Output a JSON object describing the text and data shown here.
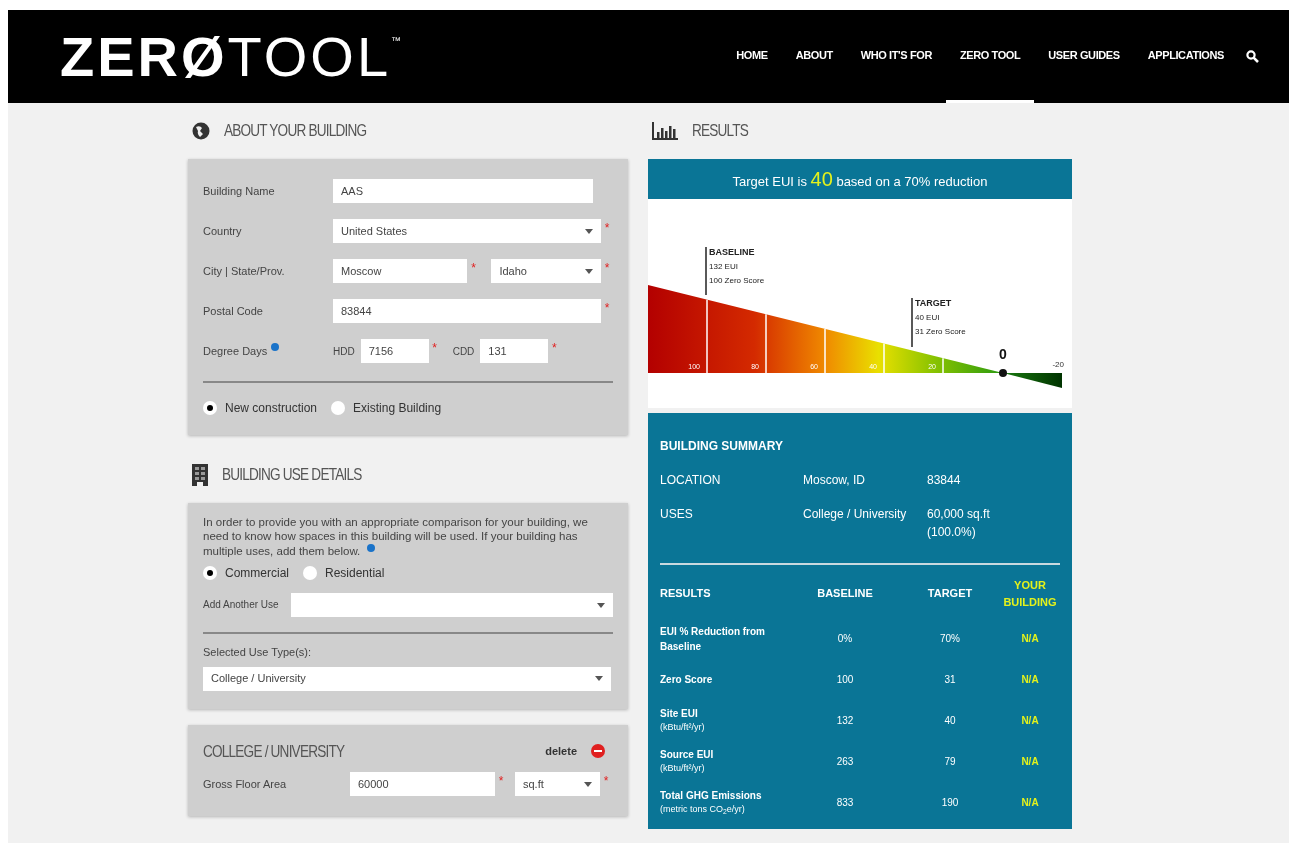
{
  "header": {
    "logo": {
      "bold": "ZERØ",
      "light": "TOOL",
      "mark": "™"
    },
    "nav": [
      {
        "label": "HOME",
        "selected": false
      },
      {
        "label": "ABOUT",
        "selected": false
      },
      {
        "label": "WHO IT'S FOR",
        "selected": false
      },
      {
        "label": "ZERO TOOL",
        "selected": true
      },
      {
        "label": "USER GUIDES",
        "selected": false
      },
      {
        "label": "APPLICATIONS",
        "selected": false
      }
    ]
  },
  "about": {
    "title": "ABOUT YOUR BUILDING",
    "fields": [
      {
        "label": "Building Name",
        "info": false,
        "inputs": [
          {
            "kind": "text",
            "value": "AAS"
          }
        ]
      },
      {
        "label": "Country",
        "info": false,
        "inputs": [
          {
            "kind": "select",
            "value": "United States",
            "required_mark": "*"
          }
        ]
      },
      {
        "label": "City | State/Prov.",
        "info": false,
        "inputs": [
          {
            "kind": "text",
            "value": "Moscow",
            "required_mark": "*"
          },
          {
            "kind": "select",
            "value": "Idaho",
            "required_mark": "*"
          }
        ]
      },
      {
        "label": "Postal Code",
        "info": false,
        "inputs": [
          {
            "kind": "text",
            "value": "83844",
            "required_mark": "*"
          }
        ]
      },
      {
        "label": "Degree Days",
        "info": true,
        "inputs": [
          {
            "kind": "text",
            "prefix": "HDD",
            "value": "7156",
            "required_mark": "*"
          },
          {
            "kind": "text",
            "prefix": "CDD",
            "value": "131",
            "required_mark": "*"
          }
        ]
      }
    ],
    "radios": [
      {
        "label": "New construction",
        "selected": true
      },
      {
        "label": "Existing Building",
        "selected": false
      }
    ]
  },
  "use_details": {
    "title": "BUILDING USE DETAILS",
    "intro": "In order to provide you with an appropriate comparison for your building, we need to know how spaces in this building will be used. If your building has multiple uses, add them below.",
    "radios": [
      {
        "label": "Commercial",
        "selected": true
      },
      {
        "label": "Residential",
        "selected": false
      }
    ],
    "add_use_label": "Add Another Use",
    "selected_label": "Selected Use Type(s):",
    "selected_value": "College / University"
  },
  "use_card": {
    "title": "COLLEGE / UNIVERSITY",
    "delete": "delete",
    "label": "Gross Floor Area",
    "inputs": [
      {
        "kind": "text",
        "value": "60000",
        "required_mark": "*"
      },
      {
        "kind": "select",
        "value": "sq.ft",
        "required_mark": "*"
      }
    ]
  },
  "results": {
    "title": "RESULTS",
    "banner": "Target EUI is **40** based on a 70% reduction",
    "gauge": {
      "scale": [
        "100",
        "80",
        "60",
        "40",
        "20"
      ],
      "zero": "0",
      "negative": "-20",
      "baseline": [
        "BASELINE",
        "132 EUI",
        "100 Zero Score"
      ],
      "target": [
        "TARGET",
        "40 EUI",
        "31 Zero Score"
      ]
    },
    "summary": {
      "title": "BUILDING SUMMARY",
      "rows": [
        {
          "label": "LOCATION",
          "values": [
            "Moscow, ID",
            "83844"
          ]
        },
        {
          "label": "USES",
          "values": [
            "College / University",
            "60,000 sq.ft (100.0%)"
          ]
        }
      ]
    },
    "table": {
      "metric_header": "RESULTS",
      "columns": [
        {
          "label": "BASELINE",
          "highlight": false
        },
        {
          "label": "TARGET",
          "highlight": false
        },
        {
          "label": "YOUR BUILDING",
          "highlight": true
        }
      ],
      "rows": [
        {
          "metric": "EUI % Reduction from Baseline",
          "cells": [
            "0%",
            "70%",
            "N/A"
          ]
        },
        {
          "metric": "Zero Score",
          "cells": [
            "100",
            "31",
            "N/A"
          ]
        },
        {
          "metric": "Site EUI",
          "unit": "(kBtu/ft²/yr)",
          "cells": [
            "132",
            "40",
            "N/A"
          ]
        },
        {
          "metric": "Source EUI",
          "unit": "(kBtu/ft²/yr)",
          "cells": [
            "263",
            "79",
            "N/A"
          ]
        },
        {
          "metric": "Total GHG Emissions",
          "unit": "(metric tons CO$_{2}$e/yr)",
          "cells": [
            "833",
            "190",
            "N/A"
          ]
        }
      ]
    }
  }
}
